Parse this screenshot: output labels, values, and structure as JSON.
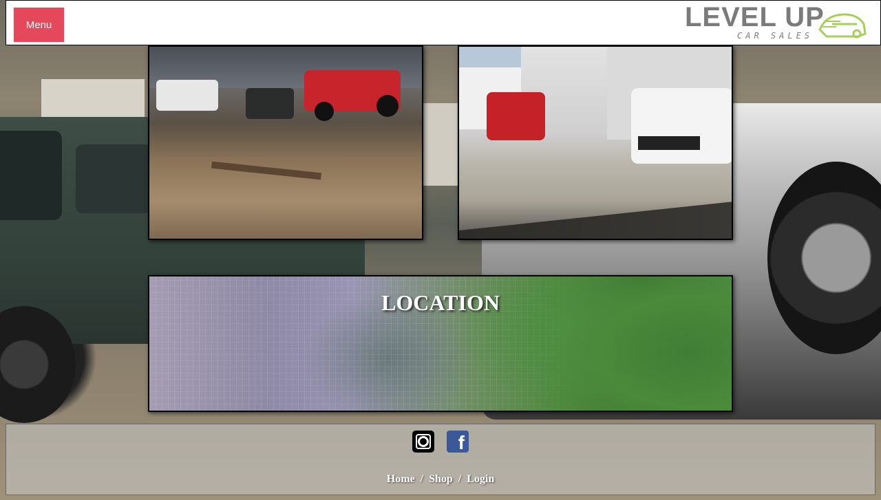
{
  "header": {
    "menu_label": "Menu",
    "logo": {
      "title": "LEVEL UP",
      "subtitle": "CAR SALES",
      "accent": "#a6cf5a"
    }
  },
  "location": {
    "title": "LOCATION"
  },
  "footer": {
    "social": [
      {
        "icon": "instagram-icon",
        "label": ""
      },
      {
        "icon": "facebook-icon",
        "label": "f"
      }
    ],
    "nav": {
      "home": "Home",
      "shop": "Shop",
      "login": "Login",
      "separator": "/"
    }
  },
  "colors": {
    "menu_button": "#e5485a",
    "facebook": "#3b5998"
  }
}
